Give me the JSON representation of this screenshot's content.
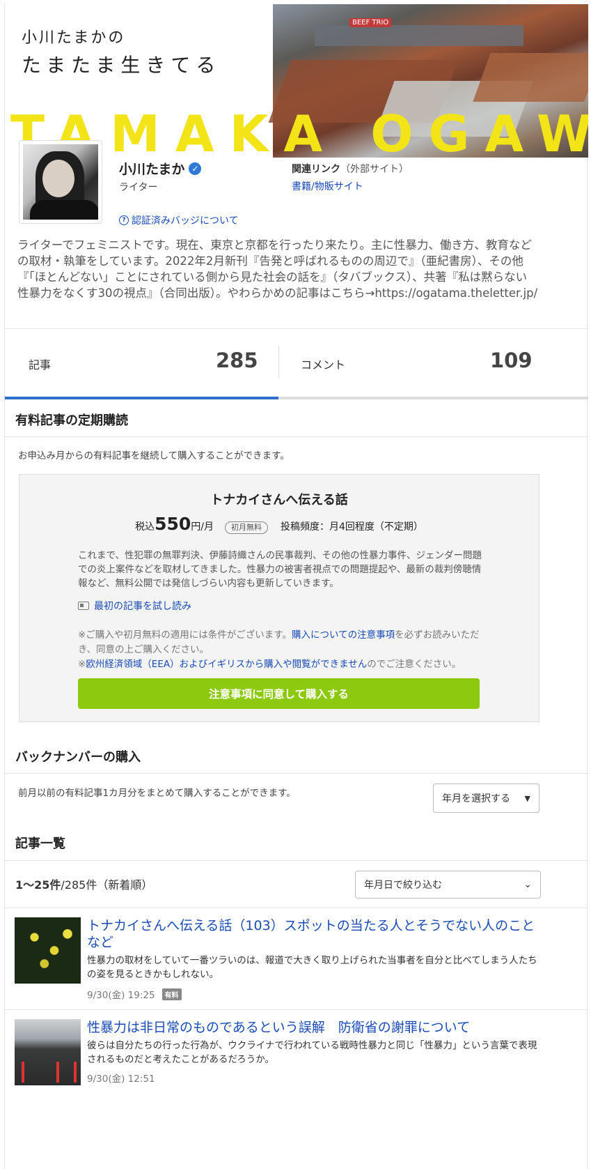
{
  "banner": {
    "subtitle": "小川たまかの",
    "title": "たまたま生きてる",
    "big_text": "TAMAKA OGAWA",
    "sign_text": "BEEF TRIO"
  },
  "profile": {
    "name": "小川たまか",
    "role": "ライター",
    "verified_icon": "verified-check-icon",
    "badge_about": "認証済みバッジについて",
    "related_label": "関連リンク",
    "related_ext": "（外部サイト）",
    "related_link": "書籍/物販サイト",
    "bio": "ライターでフェミニストです。現在、東京と京都を行ったり来たり。主に性暴力、働き方、教育などの取材・執筆をしています。2022年2月新刊『告発と呼ばれるものの周辺で』（亜紀書房）、その他『「ほとんどない」ことにされている側から見た社会の話を』（タバブックス）、共著『私は黙らない 性暴力をなくす30の視点』（合同出版）。やわらかめの記事はこちら→https://ogatama.theletter.jp/"
  },
  "stats": {
    "articles_label": "記事",
    "articles_value": "285",
    "comments_label": "コメント",
    "comments_value": "109"
  },
  "subscription": {
    "section_title": "有料記事の定期購読",
    "desc": "お申込み月からの有料記事を継続して購入することができます。",
    "plan_title": "トナカイさんへ伝える話",
    "price_prefix": "税込",
    "price": "550",
    "price_suffix": "円/月",
    "free_pill": "初月無料",
    "frequency": "投稿頻度：月4回程度（不定期）",
    "plan_desc": "これまで、性犯罪の無罪判決、伊藤詩織さんの民事裁判、その他の性暴力事件、ジェンダー問題での炎上案件などを取材してきました。性暴力の被害者視点での問題提起や、最新の裁判傍聴情報など、無料公開では発信しづらい内容も更新していきます。",
    "trial_link": "最初の記事を試し読み",
    "note1_pre": "※ご購入や初月無料の適用には条件がございます。",
    "note1_link": "購入についての注意事項",
    "note1_post": "を必ずお読みいただき、同意の上ご購入ください。",
    "note2_pre": "※",
    "note2_link": "欧州経済領域（EEA）およびイギリスから購入や閲覧ができません",
    "note2_post": "のでご注意ください。",
    "buy_button": "注意事項に同意して購入する"
  },
  "backnumber": {
    "section_title": "バックナンバーの購入",
    "desc": "前月以前の有料記事1カ月分をまとめて購入することができます。",
    "select_label": "年月を選択する"
  },
  "articles": {
    "section_title": "記事一覧",
    "range": "1〜25件",
    "total": "/285件（新着順）",
    "filter_label": "年月日で絞り込む",
    "items": [
      {
        "title": "トナカイさんへ伝える話（103）スポットの当たる人とそうでない人のことなど",
        "body": "性暴力の取材をしていて一番ツラいのは、報道で大きく取り上げられた当事者を自分と比べてしまう人たちの姿を見るときかもしれない。",
        "date": "9/30(金) 19:25",
        "badge": "有料"
      },
      {
        "title": "性暴力は非日常のものであるという誤解　防衛省の謝罪について",
        "body": "彼らは自分たちの行った行為が、ウクライナで行われている戦時性暴力と同じ「性暴力」という言葉で表現されるものだと考えたことがあるだろうか。",
        "date": "9/30(金) 12:51"
      }
    ]
  },
  "colors": {
    "accent": "#2e6fd0",
    "link": "#1a4ab5",
    "buy_button": "#8cc90f",
    "banner_text": "#f2e417"
  }
}
